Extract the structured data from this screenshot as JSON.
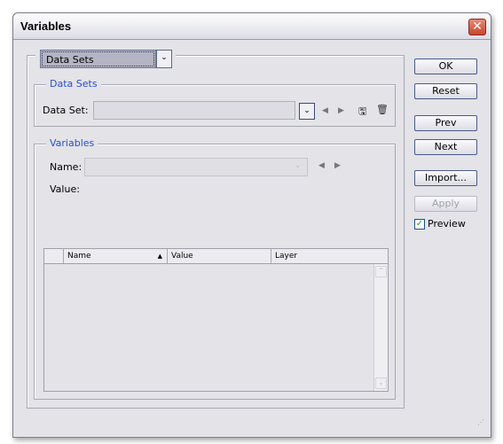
{
  "window": {
    "title": "Variables"
  },
  "mode_select": {
    "value": "Data Sets"
  },
  "data_sets": {
    "legend": "Data Sets",
    "label": "Data Set:",
    "value": ""
  },
  "variables": {
    "legend": "Variables",
    "name_label": "Name:",
    "value_label": "Value:",
    "name_value": ""
  },
  "table": {
    "columns": [
      "Name",
      "Value",
      "Layer"
    ],
    "sort_column": "Name",
    "sort_dir": "ascending",
    "rows": []
  },
  "buttons": {
    "ok": "OK",
    "reset": "Reset",
    "prev": "Prev",
    "next": "Next",
    "import": "Import...",
    "apply": "Apply"
  },
  "preview": {
    "label": "Preview",
    "checked": true
  },
  "icons": {
    "close": "close-icon",
    "prev": "triangle-left-icon",
    "next": "triangle-right-icon",
    "save": "save-dataset-icon",
    "delete": "trash-icon"
  }
}
